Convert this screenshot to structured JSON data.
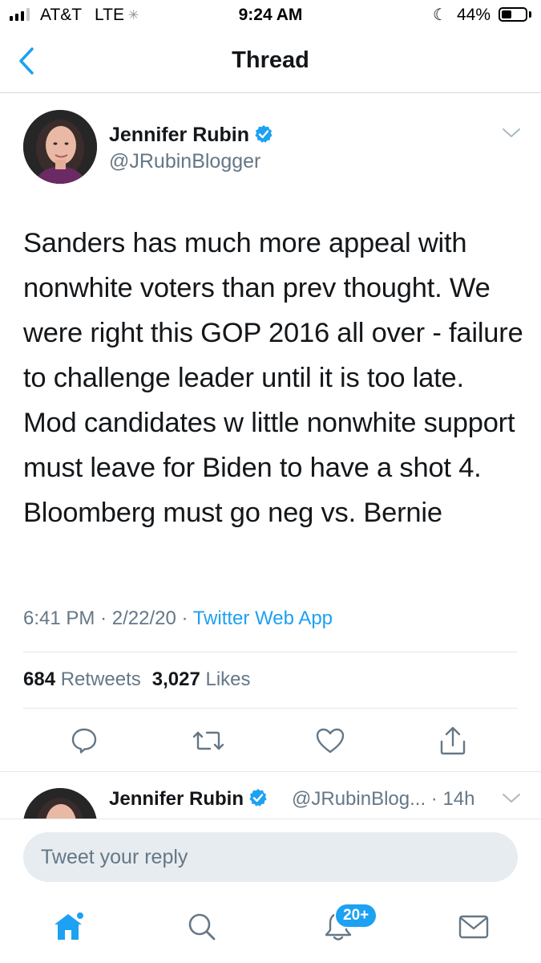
{
  "status_bar": {
    "carrier": "AT&T",
    "network": "LTE",
    "time": "9:24 AM",
    "battery_percent": "44%",
    "battery_level": 0.44,
    "signal_bars": 3
  },
  "nav": {
    "back_icon": "chevron-left-icon",
    "title": "Thread"
  },
  "tweet": {
    "display_name": "Jennifer Rubin",
    "verified": true,
    "handle": "@JRubinBlogger",
    "text": "Sanders has much more appeal with nonwhite voters than prev thought. We were right this GOP 2016 all over - failure to challenge leader until it is too late. Mod candidates w little nonwhite support must leave for Biden to have a shot 4. Bloomberg must go neg vs. Bernie",
    "time": "6:41 PM",
    "separator": "·",
    "date": "2/22/20",
    "source": "Twitter Web App",
    "retweets_count": "684",
    "retweets_label": "Retweets",
    "likes_count": "3,027",
    "likes_label": "Likes",
    "actions": [
      "reply-icon",
      "retweet-icon",
      "like-icon",
      "share-icon"
    ]
  },
  "second_tweet": {
    "display_name": "Jennifer Rubin",
    "verified": true,
    "handle": "@JRubinBlog...",
    "age": "· 14h"
  },
  "reply": {
    "placeholder": "Tweet your reply"
  },
  "tab_bar": {
    "tabs": [
      "home-icon",
      "search-icon",
      "notifications-icon",
      "messages-icon"
    ],
    "notifications_badge": "20+"
  },
  "colors": {
    "accent": "#1da1f2",
    "text": "#14171a",
    "secondary": "#657786",
    "divider": "#e1e8ed",
    "input_bg": "#e6ecf0"
  }
}
